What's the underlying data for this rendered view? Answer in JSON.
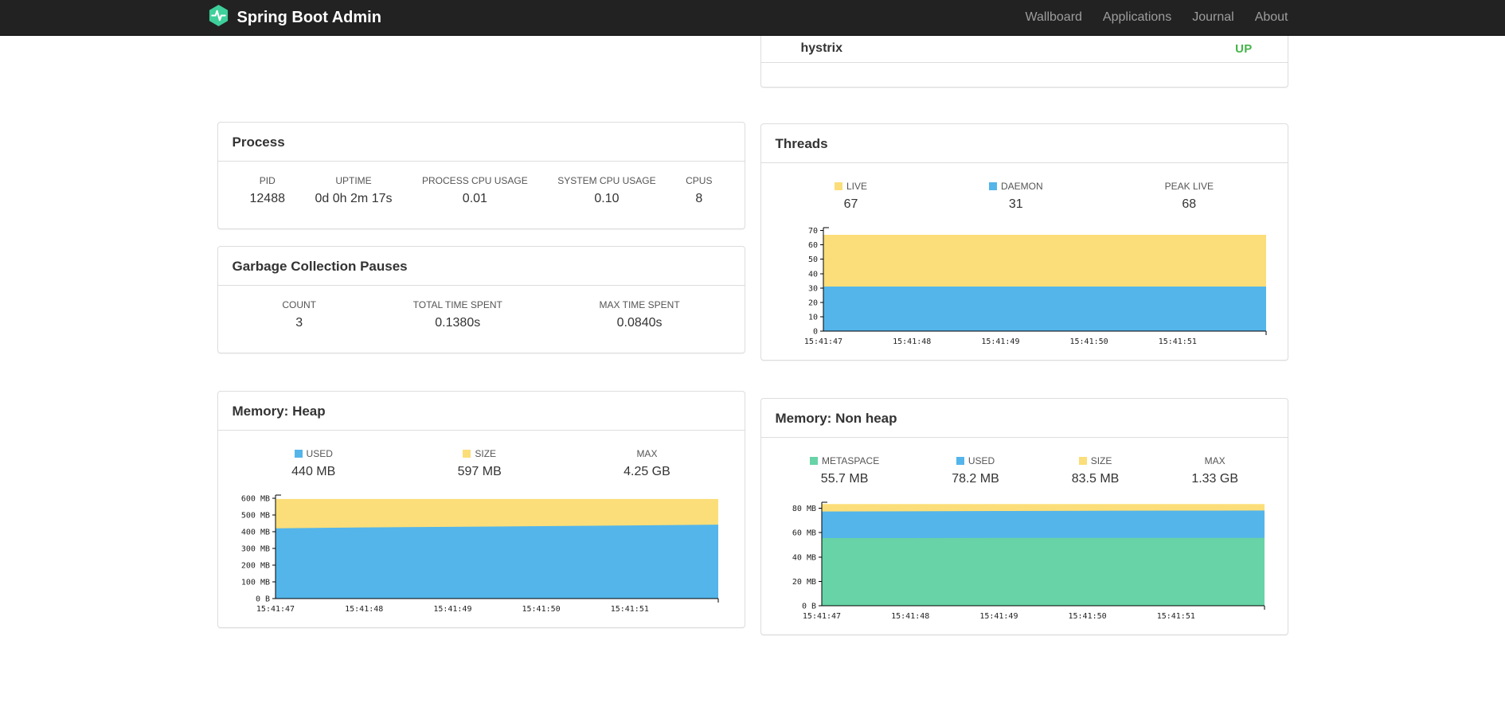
{
  "navbar": {
    "brand": "Spring Boot Admin",
    "brand_color": "#3ECF9B",
    "items": [
      {
        "label": "Wallboard"
      },
      {
        "label": "Applications"
      },
      {
        "label": "Journal"
      },
      {
        "label": "About"
      }
    ]
  },
  "application_status": {
    "name": "hystrix",
    "status": "UP",
    "status_color": "#44B549"
  },
  "process": {
    "title": "Process",
    "stats": [
      {
        "label": "PID",
        "value": "12488"
      },
      {
        "label": "UPTIME",
        "value": "0d 0h 2m 17s"
      },
      {
        "label": "PROCESS CPU USAGE",
        "value": "0.01"
      },
      {
        "label": "SYSTEM CPU USAGE",
        "value": "0.10"
      },
      {
        "label": "CPUS",
        "value": "8"
      }
    ]
  },
  "gc": {
    "title": "Garbage Collection Pauses",
    "stats": [
      {
        "label": "COUNT",
        "value": "3"
      },
      {
        "label": "TOTAL TIME SPENT",
        "value": "0.1380s"
      },
      {
        "label": "MAX TIME SPENT",
        "value": "0.0840s"
      }
    ]
  },
  "threads": {
    "title": "Threads",
    "legend": [
      {
        "label": "LIVE",
        "value": "67",
        "color": "#FBDE79"
      },
      {
        "label": "DAEMON",
        "value": "31",
        "color": "#54B5EA"
      },
      {
        "label": "PEAK LIVE",
        "value": "68",
        "color": null
      }
    ]
  },
  "memory_heap": {
    "title": "Memory: Heap",
    "legend": [
      {
        "label": "USED",
        "value": "440 MB",
        "color": "#54B5EA"
      },
      {
        "label": "SIZE",
        "value": "597 MB",
        "color": "#FBDE79"
      },
      {
        "label": "MAX",
        "value": "4.25 GB",
        "color": null
      }
    ]
  },
  "memory_nonheap": {
    "title": "Memory: Non heap",
    "legend": [
      {
        "label": "METASPACE",
        "value": "55.7 MB",
        "color": "#67D3A6"
      },
      {
        "label": "USED",
        "value": "78.2 MB",
        "color": "#54B5EA"
      },
      {
        "label": "SIZE",
        "value": "83.5 MB",
        "color": "#FBDE79"
      },
      {
        "label": "MAX",
        "value": "1.33 GB",
        "color": null
      }
    ]
  },
  "chart_data": [
    {
      "id": "threads",
      "type": "area",
      "title": "Threads",
      "x_labels": [
        "15:41:47",
        "15:41:48",
        "15:41:49",
        "15:41:50",
        "15:41:51"
      ],
      "n_points": 6,
      "ylim": [
        0,
        72
      ],
      "yticks": [
        {
          "v": 0,
          "label": "0"
        },
        {
          "v": 10,
          "label": "10"
        },
        {
          "v": 20,
          "label": "20"
        },
        {
          "v": 30,
          "label": "30"
        },
        {
          "v": 40,
          "label": "40"
        },
        {
          "v": 50,
          "label": "50"
        },
        {
          "v": 60,
          "label": "60"
        },
        {
          "v": 70,
          "label": "70"
        }
      ],
      "series": [
        {
          "name": "LIVE",
          "color": "#FBDE79",
          "values": [
            67,
            67,
            67,
            67,
            67,
            67
          ]
        },
        {
          "name": "DAEMON",
          "color": "#54B5EA",
          "values": [
            31,
            31,
            31,
            31,
            31,
            31
          ]
        }
      ]
    },
    {
      "id": "memory-heap",
      "type": "area",
      "title": "Memory: Heap",
      "x_labels": [
        "15:41:47",
        "15:41:48",
        "15:41:49",
        "15:41:50",
        "15:41:51"
      ],
      "n_points": 6,
      "ylim": [
        0,
        620
      ],
      "yticks": [
        {
          "v": 0,
          "label": "0 B"
        },
        {
          "v": 100,
          "label": "100 MB"
        },
        {
          "v": 200,
          "label": "200 MB"
        },
        {
          "v": 300,
          "label": "300 MB"
        },
        {
          "v": 400,
          "label": "400 MB"
        },
        {
          "v": 500,
          "label": "500 MB"
        },
        {
          "v": 600,
          "label": "600 MB"
        }
      ],
      "series": [
        {
          "name": "SIZE",
          "color": "#FBDE79",
          "values": [
            597,
            597,
            597,
            597,
            597,
            597
          ]
        },
        {
          "name": "USED",
          "color": "#54B5EA",
          "values": [
            421,
            426,
            430,
            434,
            438,
            443
          ]
        }
      ]
    },
    {
      "id": "memory-nonheap",
      "type": "area",
      "title": "Memory: Non heap",
      "x_labels": [
        "15:41:47",
        "15:41:48",
        "15:41:49",
        "15:41:50",
        "15:41:51"
      ],
      "n_points": 6,
      "ylim": [
        0,
        85
      ],
      "yticks": [
        {
          "v": 0,
          "label": "0 B"
        },
        {
          "v": 20,
          "label": "20 MB"
        },
        {
          "v": 40,
          "label": "40 MB"
        },
        {
          "v": 60,
          "label": "60 MB"
        },
        {
          "v": 80,
          "label": "80 MB"
        }
      ],
      "series": [
        {
          "name": "SIZE",
          "color": "#FBDE79",
          "values": [
            83.5,
            83.5,
            83.5,
            83.5,
            83.5,
            83.5
          ]
        },
        {
          "name": "USED",
          "color": "#54B5EA",
          "values": [
            77.4,
            77.6,
            77.8,
            78.0,
            78.1,
            78.2
          ]
        },
        {
          "name": "METASPACE",
          "color": "#67D3A6",
          "values": [
            55.6,
            55.6,
            55.7,
            55.7,
            55.7,
            55.7
          ]
        }
      ]
    }
  ]
}
